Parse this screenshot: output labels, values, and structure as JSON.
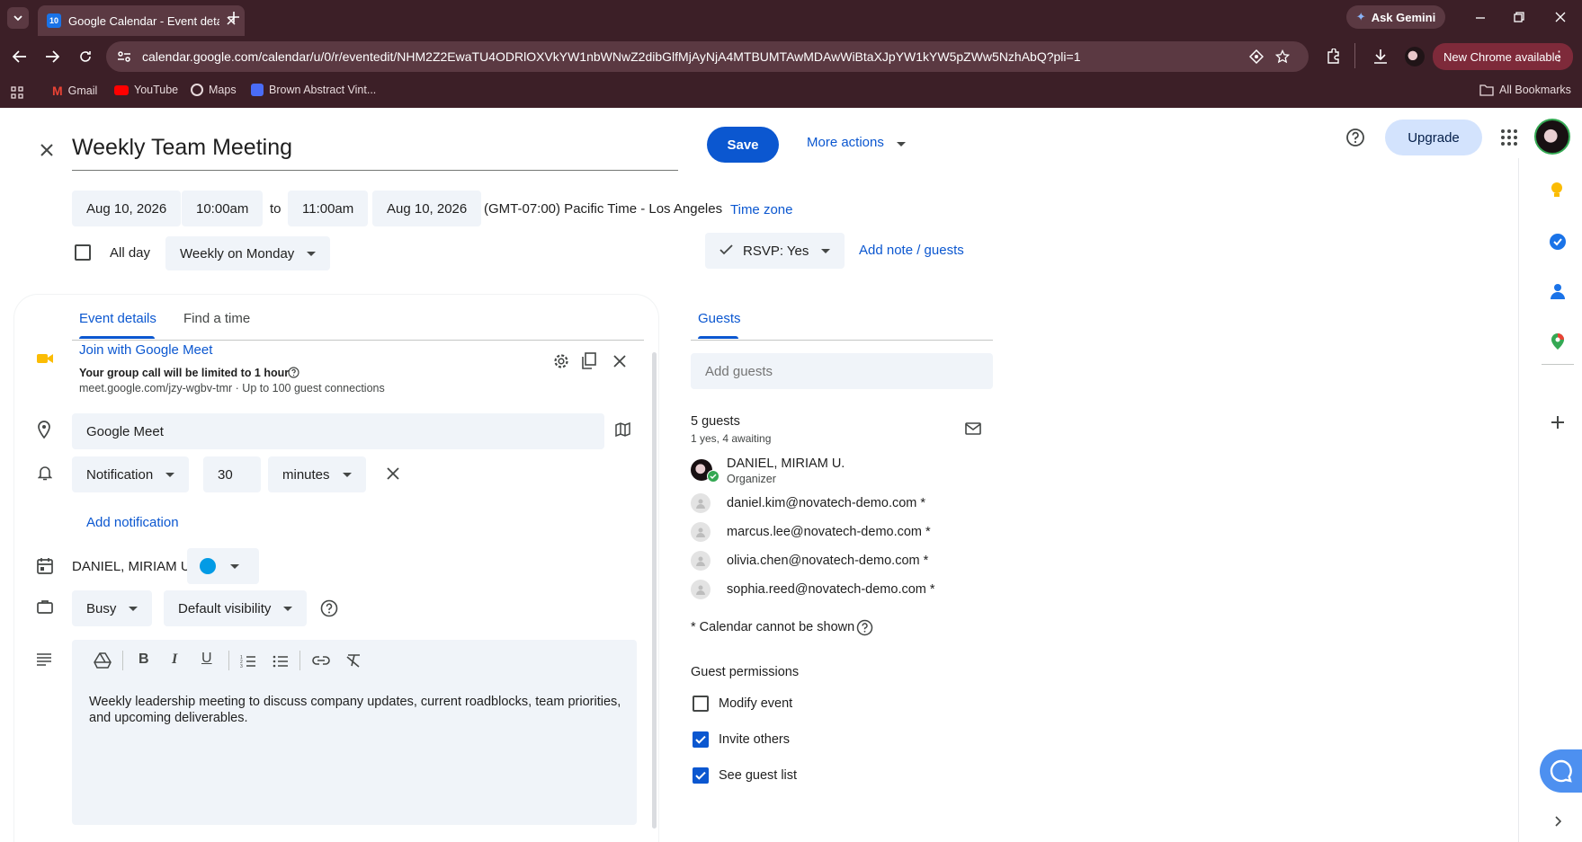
{
  "browser": {
    "tab_title": "Google Calendar - Event details",
    "tab_favicon_text": "10",
    "url": "calendar.google.com/calendar/u/0/r/eventedit/NHM2Z2EwaTU4ODRlOXVkYW1nbWNwZ2dibGlfMjAyNjA4MTBUMTAwMDAwWiBtaXJpYW1kYW5pZWw5NzhAbQ?pli=1",
    "ask_gemini": "Ask Gemini",
    "new_chrome": "New Chrome available",
    "bookmarks": [
      "Gmail",
      "YouTube",
      "Maps",
      "Brown Abstract Vint..."
    ],
    "all_bookmarks": "All Bookmarks"
  },
  "header": {
    "title": "Weekly Team Meeting",
    "save": "Save",
    "more_actions": "More actions",
    "upgrade": "Upgrade"
  },
  "datetime": {
    "start_date": "Aug 10, 2026",
    "start_time": "10:00am",
    "to": "to",
    "end_time": "11:00am",
    "end_date": "Aug 10, 2026",
    "timezone": "(GMT-07:00) Pacific Time - Los Angeles",
    "timezone_link": "Time zone",
    "all_day": "All day",
    "recurrence": "Weekly on Monday",
    "rsvp": "RSVP: Yes",
    "add_note": "Add note / guests"
  },
  "tabs": {
    "event_details": "Event details",
    "find_time": "Find a time",
    "guests": "Guests"
  },
  "meet": {
    "join": "Join with Google Meet",
    "limit": "Your group call will be limited to 1 hour",
    "info": "meet.google.com/jzy-wgbv-tmr · Up to 100 guest connections"
  },
  "location": "Google Meet",
  "notification": {
    "type": "Notification",
    "value": "30",
    "unit": "minutes",
    "add": "Add notification"
  },
  "calendar_owner": "DANIEL, MIRIAM U.",
  "calendar_color": "#039be5",
  "busy": "Busy",
  "visibility": "Default visibility",
  "description": "Weekly leadership meeting to discuss company updates, current roadblocks, team priorities, and upcoming deliverables.",
  "guests": {
    "add_placeholder": "Add guests",
    "count": "5 guests",
    "summary": "1 yes, 4 awaiting",
    "organizer_name": "DANIEL, MIRIAM U.",
    "organizer_label": "Organizer",
    "list": [
      "daniel.kim@novatech-demo.com *",
      "marcus.lee@novatech-demo.com *",
      "olivia.chen@novatech-demo.com *",
      "sophia.reed@novatech-demo.com *"
    ],
    "calendar_note": "* Calendar cannot be shown",
    "permissions_title": "Guest permissions",
    "permissions": [
      {
        "label": "Modify event",
        "checked": false
      },
      {
        "label": "Invite others",
        "checked": true
      },
      {
        "label": "See guest list",
        "checked": true
      }
    ]
  },
  "colors": {
    "accent": "#0b57d0",
    "chrome_bg": "#3c1f27",
    "field_bg": "#f0f4f9"
  }
}
